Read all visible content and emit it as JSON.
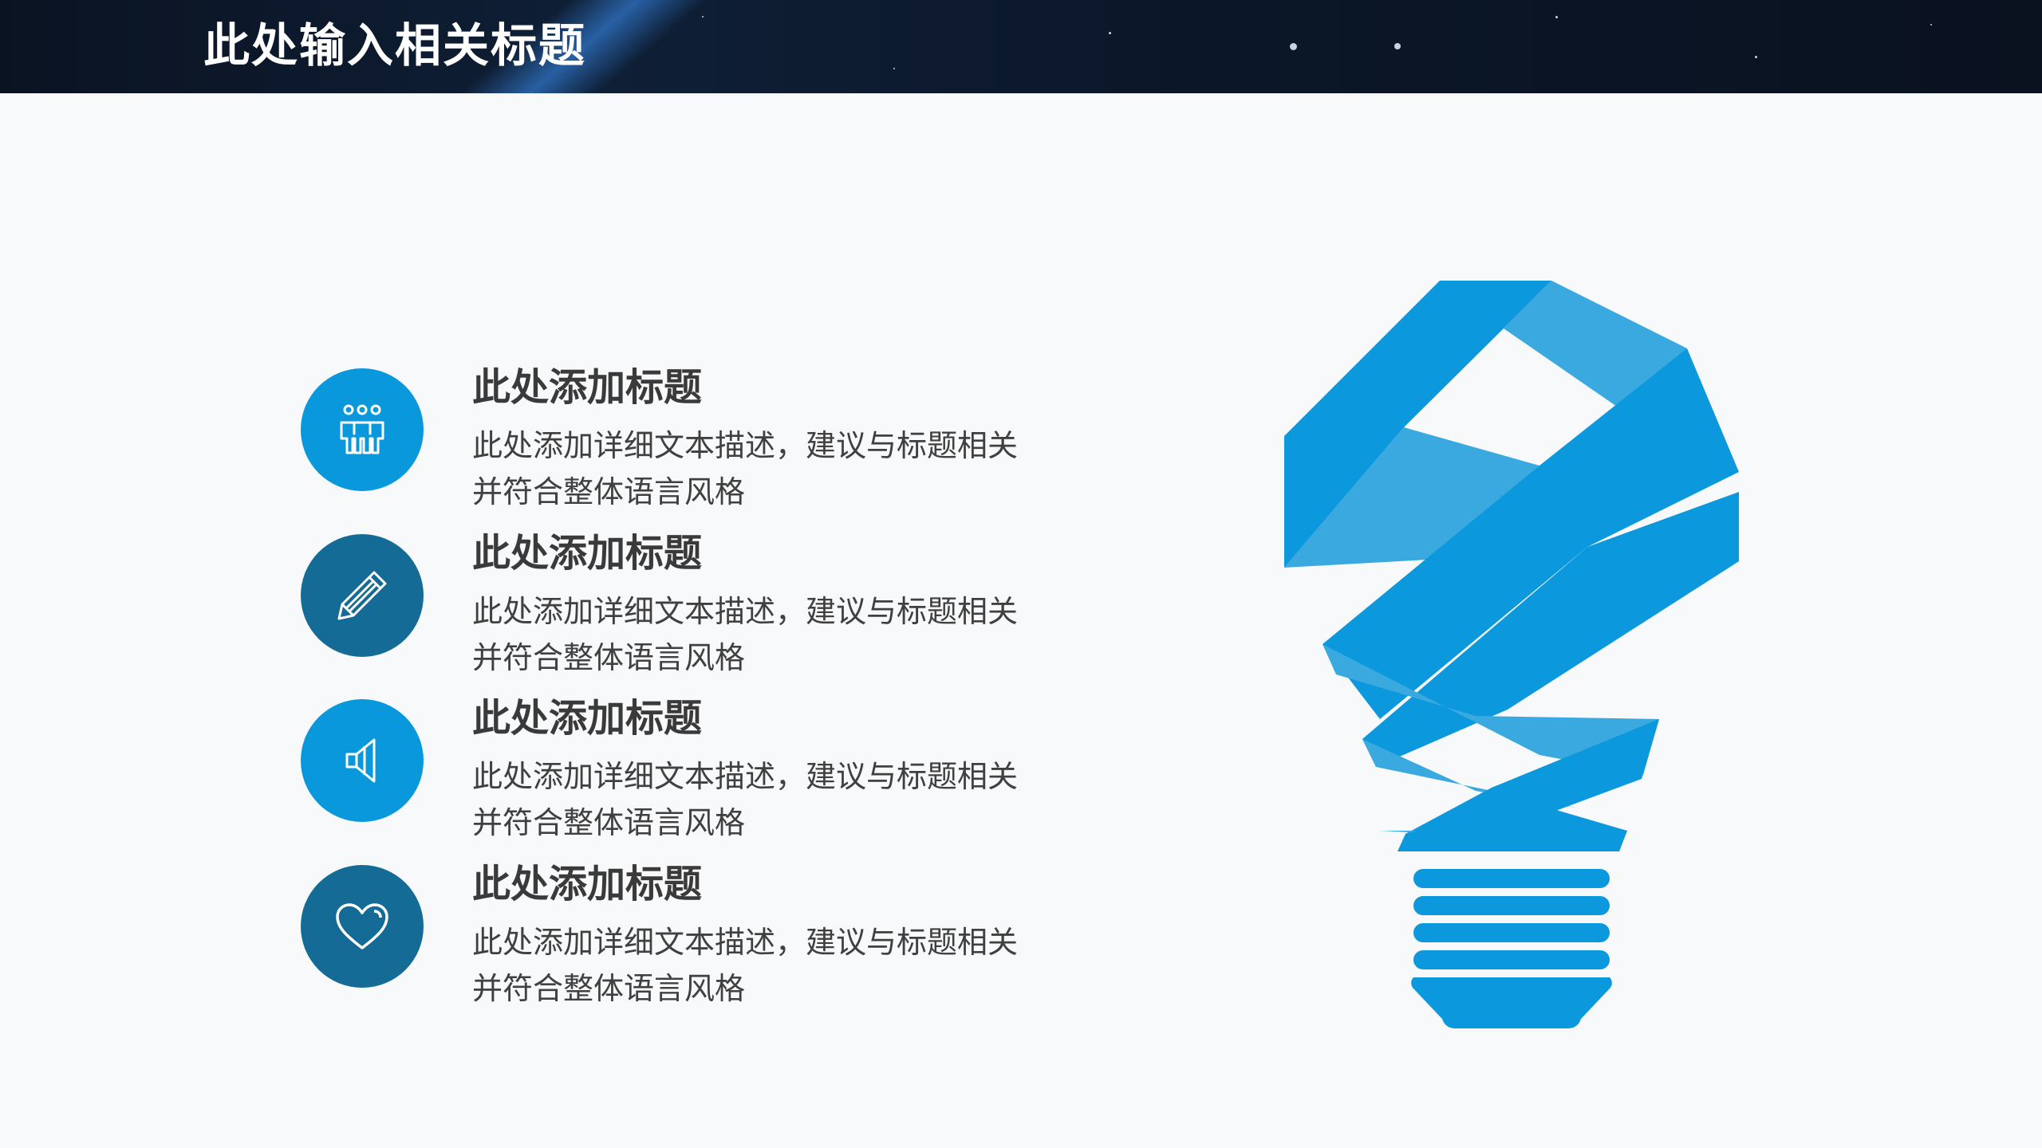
{
  "header": {
    "title": "此处输入相关标题"
  },
  "items": [
    {
      "icon": "people-icon",
      "title": "此处添加标题",
      "description": "此处添加详细文本描述，建议与标题相关并符合整体语言风格"
    },
    {
      "icon": "pencil-icon",
      "title": "此处添加标题",
      "description": "此处添加详细文本描述，建议与标题相关并符合整体语言风格"
    },
    {
      "icon": "speaker-icon",
      "title": "此处添加标题",
      "description": "此处添加详细文本描述，建议与标题相关并符合整体语言风格"
    },
    {
      "icon": "heart-icon",
      "title": "此处添加标题",
      "description": "此处添加详细文本描述，建议与标题相关并符合整体语言风格"
    }
  ],
  "colors": {
    "accent_light": "#0a98dc",
    "accent_dark": "#136b96",
    "header_bg": "#0b1628",
    "title_text": "#3a3a3a",
    "body_text": "#404040",
    "bulb_blue": "#0b98dd"
  }
}
